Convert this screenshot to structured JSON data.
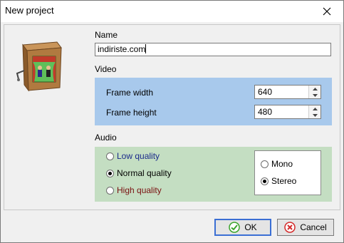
{
  "window": {
    "title": "New project"
  },
  "name": {
    "label": "Name",
    "value": "indiriste.com"
  },
  "video": {
    "label": "Video",
    "frame_width_label": "Frame width",
    "frame_width_value": "640",
    "frame_height_label": "Frame height",
    "frame_height_value": "480"
  },
  "audio": {
    "label": "Audio",
    "quality_options": [
      {
        "label": "Low quality",
        "color": "#1a2a8a",
        "checked": false
      },
      {
        "label": "Normal quality",
        "color": "#000000",
        "checked": true
      },
      {
        "label": "High quality",
        "color": "#7a1010",
        "checked": false
      }
    ],
    "channel_options": [
      {
        "label": "Mono",
        "checked": false
      },
      {
        "label": "Stereo",
        "checked": true
      }
    ]
  },
  "buttons": {
    "ok_label": "OK",
    "cancel_label": "Cancel"
  },
  "colors": {
    "video_panel": "#a8c9ec",
    "audio_panel": "#c4dec2",
    "ok_icon": "#3aa52b",
    "cancel_icon": "#d42a2a"
  },
  "icons": {
    "app_logo": "puppet-theater-icon",
    "close": "close-icon",
    "ok": "check-circle-icon",
    "cancel": "x-circle-icon",
    "spin_up": "spin-up-arrow-icon",
    "spin_down": "spin-down-arrow-icon"
  }
}
